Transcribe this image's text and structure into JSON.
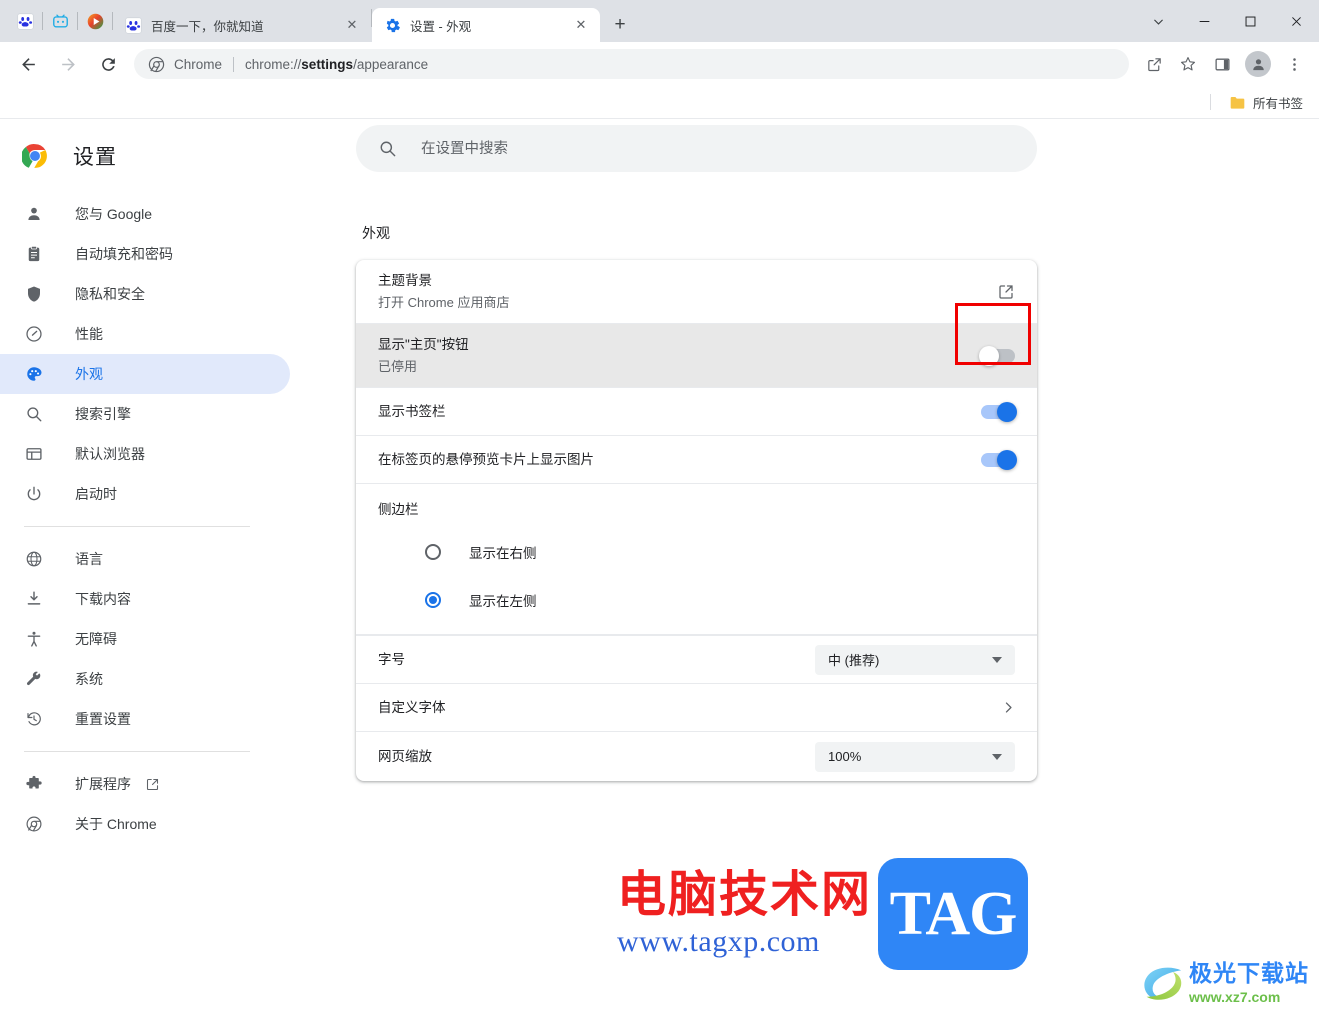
{
  "window": {
    "controls": {
      "tab_search": "tab-search",
      "minimize": "minimize",
      "maximize": "maximize",
      "close": "close"
    }
  },
  "tabstrip": {
    "pinned": [
      {
        "name": "baidu-pinned-tab",
        "icon": "baidu-icon"
      },
      {
        "name": "bilibili-pinned-tab",
        "icon": "bilibili-icon"
      },
      {
        "name": "video-pinned-tab",
        "icon": "play-icon"
      }
    ],
    "tabs": [
      {
        "title": "百度一下，你就知道",
        "icon": "baidu-icon",
        "active": false
      },
      {
        "title": "设置 - 外观",
        "icon": "settings-gear-icon",
        "active": true
      }
    ],
    "new_tab_label": "+",
    "close_label": "✕"
  },
  "toolbar": {
    "back": "←",
    "forward": "→",
    "reload": "⟳",
    "omnibox": {
      "scheme_label": "Chrome",
      "url_prefix": "chrome://",
      "url_bold": "settings",
      "url_suffix": "/appearance"
    },
    "icons": [
      "share-icon",
      "bookmark-star-icon",
      "side-panel-icon",
      "profile-avatar-icon",
      "three-dot-menu-icon"
    ]
  },
  "bookmarkbar": {
    "all_bookmarks_label": "所有书签"
  },
  "sidebar": {
    "title": "设置",
    "items": [
      {
        "label": "您与 Google",
        "icon": "person-icon",
        "active": false
      },
      {
        "label": "自动填充和密码",
        "icon": "clipboard-icon",
        "active": false
      },
      {
        "label": "隐私和安全",
        "icon": "shield-icon",
        "active": false
      },
      {
        "label": "性能",
        "icon": "speedometer-icon",
        "active": false
      },
      {
        "label": "外观",
        "icon": "palette-icon",
        "active": true
      },
      {
        "label": "搜索引擎",
        "icon": "search-icon",
        "active": false
      },
      {
        "label": "默认浏览器",
        "icon": "browser-window-icon",
        "active": false
      },
      {
        "label": "启动时",
        "icon": "power-icon",
        "active": false
      }
    ],
    "items2": [
      {
        "label": "语言",
        "icon": "globe-icon",
        "active": false
      },
      {
        "label": "下载内容",
        "icon": "download-icon",
        "active": false
      },
      {
        "label": "无障碍",
        "icon": "accessibility-icon",
        "active": false
      },
      {
        "label": "系统",
        "icon": "wrench-icon",
        "active": false
      },
      {
        "label": "重置设置",
        "icon": "history-restore-icon",
        "active": false
      }
    ],
    "items3": [
      {
        "label": "扩展程序",
        "icon": "puzzle-icon",
        "external": true
      },
      {
        "label": "关于 Chrome",
        "icon": "chrome-icon",
        "external": false
      }
    ]
  },
  "search": {
    "placeholder": "在设置中搜索",
    "value": "",
    "icon": "search-icon"
  },
  "main": {
    "section_title": "外观",
    "rows": {
      "theme": {
        "label": "主题背景",
        "sub": "打开 Chrome 应用商店",
        "action_icon": "external-link-icon"
      },
      "home_button": {
        "label": "显示\"主页\"按钮",
        "sub": "已停用",
        "toggle_state": "off",
        "highlighted": true
      },
      "bookmarks_bar": {
        "label": "显示书签栏",
        "toggle_state": "on"
      },
      "tab_hover_card": {
        "label": "在标签页的悬停预览卡片上显示图片",
        "toggle_state": "on"
      },
      "side_panel": {
        "group_label": "侧边栏",
        "options": [
          {
            "label": "显示在右侧",
            "checked": false
          },
          {
            "label": "显示在左侧",
            "checked": true
          }
        ]
      },
      "font_size": {
        "label": "字号",
        "value": "中 (推荐)"
      },
      "customize_fonts": {
        "label": "自定义字体",
        "action_icon": "chevron-right-icon"
      },
      "page_zoom": {
        "label": "网页缩放",
        "value": "100%"
      }
    }
  },
  "watermarks": {
    "primary": {
      "cn_text": "电脑技术网",
      "url_text": "www.tagxp.com",
      "badge_text": "TAG"
    },
    "corner": {
      "cn_text": "极光下载站",
      "url_text": "www.xz7.com"
    }
  }
}
